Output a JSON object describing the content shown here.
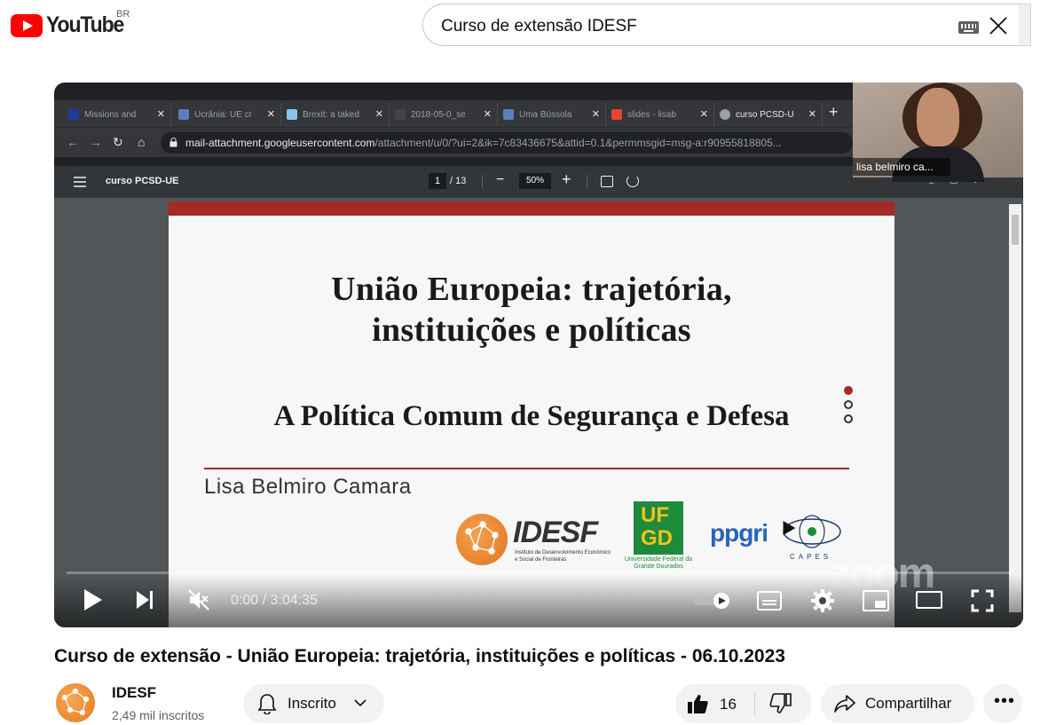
{
  "masthead": {
    "logo_text": "YouTube",
    "country_code": "BR",
    "search_value": "Curso de extensão IDESF"
  },
  "browser": {
    "tabs": [
      {
        "label": "Missions and",
        "favicon_color": "#1a3c9c"
      },
      {
        "label": "Ucrânia: UE cr",
        "favicon_color": "#5b7fbf"
      },
      {
        "label": "Brexit: a taked",
        "favicon_color": "#89c4e8"
      },
      {
        "label": "2018-05-0_se",
        "favicon_color": "#444444"
      },
      {
        "label": "Uma Bússola",
        "favicon_color": "#5b7fbf"
      },
      {
        "label": "slides - lisab",
        "favicon_color": "#ea4335"
      },
      {
        "label": "curso PCSD-U",
        "favicon_color": "#9aa0a6"
      }
    ],
    "url_host": "mail-attachment.googleusercontent.com",
    "url_path": "/attachment/u/0/?ui=2&ik=7c83436675&attid=0.1&permmsgid=msg-a:r90955818805..."
  },
  "pdf_viewer": {
    "doc_title": "curso PCSD-UE",
    "page_current": "1",
    "page_total": "/ 13",
    "zoom": "50%"
  },
  "slide": {
    "title_line1": "União Europeia: trajetória,",
    "title_line2": "instituições e políticas",
    "subtitle": "A Política Comum de Segurança e Defesa",
    "author": "Lisa Belmiro Camara",
    "logos": {
      "idesf": "IDESF",
      "idesf_sub": "Instituto de Desenvolvimento Econômico e Social de Fronteiras",
      "ufgd_line1": "UF",
      "ufgd_line2": "GD",
      "ufgd_sub": "Universidade Federal da Grande Dourados",
      "ppgri": "ppgri",
      "capes": "CAPES"
    },
    "accent_color": "#a52a24"
  },
  "zoom_watermark": "zoom",
  "webcam": {
    "participant_name": "lisa belmiro ca..."
  },
  "player": {
    "time": "0:00 / 3:04:35",
    "progress_fraction": 0.0,
    "muted": true
  },
  "video": {
    "title": "Curso de extensão - União Europeia: trajetória, instituições e políticas - 06.10.2023"
  },
  "channel": {
    "name": "IDESF",
    "subscribers": "2,49 mil inscritos",
    "subscribe_label": "Inscrito"
  },
  "actions": {
    "like_count": "16",
    "share_label": "Compartilhar",
    "more_label": "•••"
  }
}
